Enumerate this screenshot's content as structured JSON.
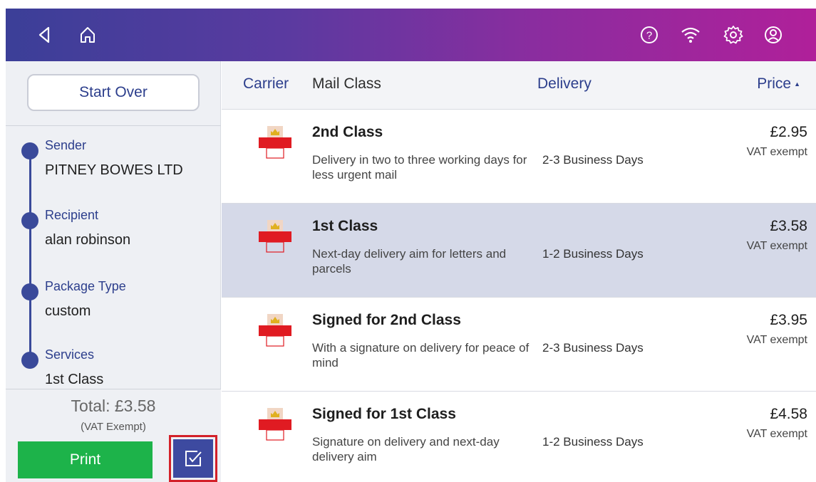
{
  "header": {
    "icons": [
      "back-icon",
      "home-icon",
      "help-icon",
      "wifi-icon",
      "settings-icon",
      "account-icon"
    ],
    "gradient": [
      "#3b3f98",
      "#b0209a"
    ]
  },
  "sidebar": {
    "start_over_label": "Start Over",
    "steps": [
      {
        "label": "Sender",
        "value": "PITNEY BOWES LTD"
      },
      {
        "label": "Recipient",
        "value": "alan robinson"
      },
      {
        "label": "Package Type",
        "value": "custom"
      },
      {
        "label": "Services",
        "value": "1st Class"
      }
    ],
    "total": "Total: £3.58",
    "vat_note": "(VAT Exempt)",
    "print_label": "Print",
    "accent_color": "#3a4a9a",
    "print_color": "#1db34a"
  },
  "table": {
    "columns": {
      "carrier": "Carrier",
      "mail_class": "Mail Class",
      "delivery": "Delivery",
      "price": "Price"
    },
    "sort": {
      "column": "price",
      "direction": "ascending"
    },
    "rows": [
      {
        "carrier_logo": "Royal Mail",
        "name": "2nd Class",
        "description": "Delivery in two to three working days for less urgent mail",
        "delivery": "2-3 Business Days",
        "price": "£2.95",
        "vat": "VAT exempt",
        "selected": false
      },
      {
        "carrier_logo": "Royal Mail",
        "name": "1st Class",
        "description": "Next-day delivery aim for letters and parcels",
        "delivery": "1-2 Business Days",
        "price": "£3.58",
        "vat": "VAT exempt",
        "selected": true
      },
      {
        "carrier_logo": "Royal Mail",
        "name": "Signed for 2nd Class",
        "description": "With a signature on delivery for peace of mind",
        "delivery": "2-3 Business Days",
        "price": "£3.95",
        "vat": "VAT exempt",
        "selected": false
      },
      {
        "carrier_logo": "Royal Mail",
        "name": "Signed for 1st Class",
        "description": "Signature on delivery and next-day delivery aim",
        "delivery": "1-2 Business Days",
        "price": "£4.58",
        "vat": "VAT exempt",
        "selected": false
      }
    ]
  }
}
